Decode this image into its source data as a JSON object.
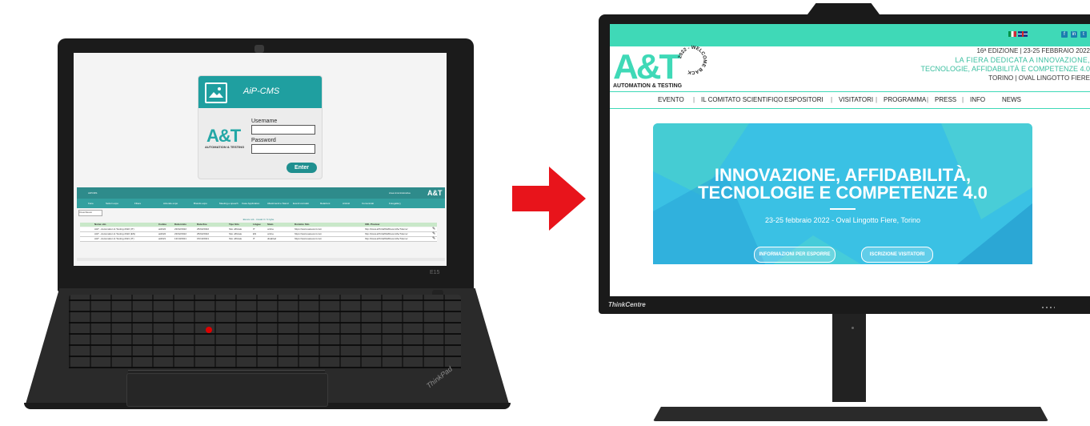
{
  "laptop": {
    "model_label": "E15",
    "brand": "ThinkPad",
    "login": {
      "app_title": "AiP-CMS",
      "logo_text": "A&T",
      "logo_sub": "AUTOMATION & TESTING",
      "username_label": "Username",
      "password_label": "Password",
      "submit_label": "Enter"
    },
    "admin": {
      "app_name": "AiPCMS",
      "user_label": "Area Amministrativa",
      "logo_text": "A&T",
      "nav": [
        "Fiere",
        "Settori expo",
        "Filiere",
        "Aziende expo",
        "Brands expo",
        "Meeting e speech",
        "Case Application",
        "Allestimenti e Stand",
        "Eventi correlati",
        "Relazioni",
        "Articoli",
        "Comunicati",
        "Fotogallery"
      ],
      "new_button": "Crea Nuovo",
      "caption": "Elenco siti - trovati 3 / 3 righe",
      "columns": [
        "Nome sito",
        "Codice",
        "Data inizio",
        "Data fine",
        "Tipo Sito",
        "Lingue",
        "Stato",
        "Dominio Sito",
        "URL Preview"
      ],
      "rows": [
        [
          "A&T - Automation & Testing 2022 (IT)",
          "at2022",
          "23/02/2022",
          "25/02/2022",
          "Sito ufficiale",
          "IT",
          "online",
          "https://www.aetevent.com",
          "http://www.aiff.it/aiff/aiff/event/AeTdemo/"
        ],
        [
          "A&T - Automation & Testing 2022 (EN)",
          "at2022",
          "23/02/2022",
          "25/02/2022",
          "Sito ufficiale",
          "EN",
          "online",
          "https://www.aetevent.com",
          "http://www.aiff.it/aiff/aiff/event/AeTdemo/"
        ],
        [
          "A&T - Automation & Testing 2021 (IT)",
          "at2021",
          "13/10/2021",
          "15/10/2021",
          "Sito ufficiale",
          "IT",
          "disabled",
          "https://www.aetevent.com",
          "http://www.aiff.it/aiff/aiff/event/AeTdemo/"
        ]
      ]
    }
  },
  "monitor": {
    "brand": "ThinkCentre",
    "site": {
      "logo_text": "A&T",
      "logo_sub": "AUTOMATION & TESTING",
      "stamp_year": "2022",
      "stamp_text": "WELCOME BACK",
      "edition": "16ª EDIZIONE | 23-25 FEBBRAIO 2022",
      "tagline_1": "LA FIERA DEDICATA A INNOVAZIONE,",
      "tagline_2": "TECNOLOGIE, AFFIDABILITÀ E COMPETENZE 4.0",
      "venue": "TORINO | OVAL LINGOTTO FIERE",
      "nav": [
        "EVENTO",
        "IL COMITATO SCIENTIFICO",
        "ESPOSITORI",
        "VISITATORI",
        "PROGRAMMA",
        "PRESS",
        "INFO",
        "NEWS"
      ],
      "hero_title_1": "INNOVAZIONE, AFFIDABILITÀ,",
      "hero_title_2": "TECNOLOGIE E COMPETENZE 4.0",
      "hero_subtitle": "23-25 febbraio 2022 - Oval Lingotto Fiere, Torino",
      "button_1": "INFORMAZIONI PER ESPORRE",
      "button_2": "ISCRIZIONE VISITATORI",
      "social": [
        "f",
        "in",
        "t"
      ]
    }
  },
  "colors": {
    "accent": "#3fd9b7",
    "cms_teal": "#1f9fa0",
    "hero_blue": "#3ac1e4",
    "arrow_red": "#e8141b"
  },
  "icons": {
    "arrow": "arrow-right-icon",
    "cms": "image-icon"
  }
}
